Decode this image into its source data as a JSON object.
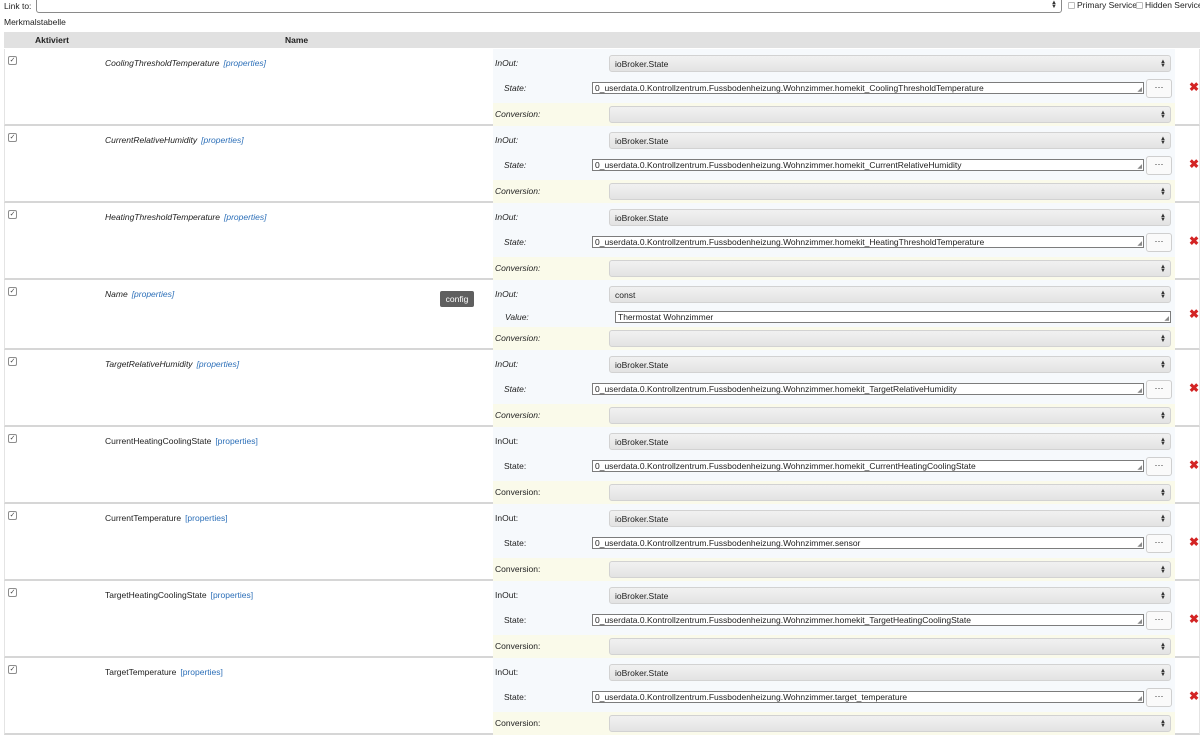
{
  "link_bar": {
    "label": "Link to:",
    "primary_service_label": "Primary Service",
    "hidden_service_label": "Hidden Service"
  },
  "table_title": "Merkmalstabelle",
  "table_header": {
    "activated": "Aktiviert",
    "name": "Name"
  },
  "tooltip": "config",
  "delete_icon": "✖",
  "props_label": "[properties]",
  "dots_label": "···",
  "colors": {
    "link": "#2c6fb8",
    "delete": "#d32424",
    "header_bg": "#e1e1e1"
  },
  "rows": [
    {
      "name": "CoolingThresholdTemperature",
      "italic": true,
      "inout_label": "InOut:",
      "inout_value": "ioBroker.State",
      "field_label": "State:",
      "field_value": "0_userdata.0.Kontrollzentrum.Fussbodenheizung.Wohnzimmer.homekit_CoolingThresholdTemperature",
      "conv_label": "Conversion:"
    },
    {
      "name": "CurrentRelativeHumidity",
      "italic": true,
      "inout_label": "InOut:",
      "inout_value": "ioBroker.State",
      "field_label": "State:",
      "field_value": "0_userdata.0.Kontrollzentrum.Fussbodenheizung.Wohnzimmer.homekit_CurrentRelativeHumidity",
      "conv_label": "Conversion:"
    },
    {
      "name": "HeatingThresholdTemperature",
      "italic": true,
      "inout_label": "InOut:",
      "inout_value": "ioBroker.State",
      "field_label": "State:",
      "field_value": "0_userdata.0.Kontrollzentrum.Fussbodenheizung.Wohnzimmer.homekit_HeatingThresholdTemperature",
      "conv_label": "Conversion:"
    },
    {
      "name": "Name",
      "italic": true,
      "inout_label": "InOut:",
      "inout_value": "const",
      "field_label": "Value:",
      "field_value": "Thermostat Wohnzimmer",
      "conv_label": "Conversion:"
    },
    {
      "name": "TargetRelativeHumidity",
      "italic": true,
      "inout_label": "InOut:",
      "inout_value": "ioBroker.State",
      "field_label": "State:",
      "field_value": "0_userdata.0.Kontrollzentrum.Fussbodenheizung.Wohnzimmer.homekit_TargetRelativeHumidity",
      "conv_label": "Conversion:"
    },
    {
      "name": "CurrentHeatingCoolingState",
      "italic": false,
      "inout_label": "InOut:",
      "inout_value": "ioBroker.State",
      "field_label": "State:",
      "field_value": "0_userdata.0.Kontrollzentrum.Fussbodenheizung.Wohnzimmer.homekit_CurrentHeatingCoolingState",
      "conv_label": "Conversion:"
    },
    {
      "name": "CurrentTemperature",
      "italic": false,
      "inout_label": "InOut:",
      "inout_value": "ioBroker.State",
      "field_label": "State:",
      "field_value": "0_userdata.0.Kontrollzentrum.Fussbodenheizung.Wohnzimmer.sensor",
      "conv_label": "Conversion:"
    },
    {
      "name": "TargetHeatingCoolingState",
      "italic": false,
      "inout_label": "InOut:",
      "inout_value": "ioBroker.State",
      "field_label": "State:",
      "field_value": "0_userdata.0.Kontrollzentrum.Fussbodenheizung.Wohnzimmer.homekit_TargetHeatingCoolingState",
      "conv_label": "Conversion:"
    },
    {
      "name": "TargetTemperature",
      "italic": false,
      "inout_label": "InOut:",
      "inout_value": "ioBroker.State",
      "field_label": "State:",
      "field_value": "0_userdata.0.Kontrollzentrum.Fussbodenheizung.Wohnzimmer.target_temperature",
      "conv_label": "Conversion:"
    }
  ]
}
